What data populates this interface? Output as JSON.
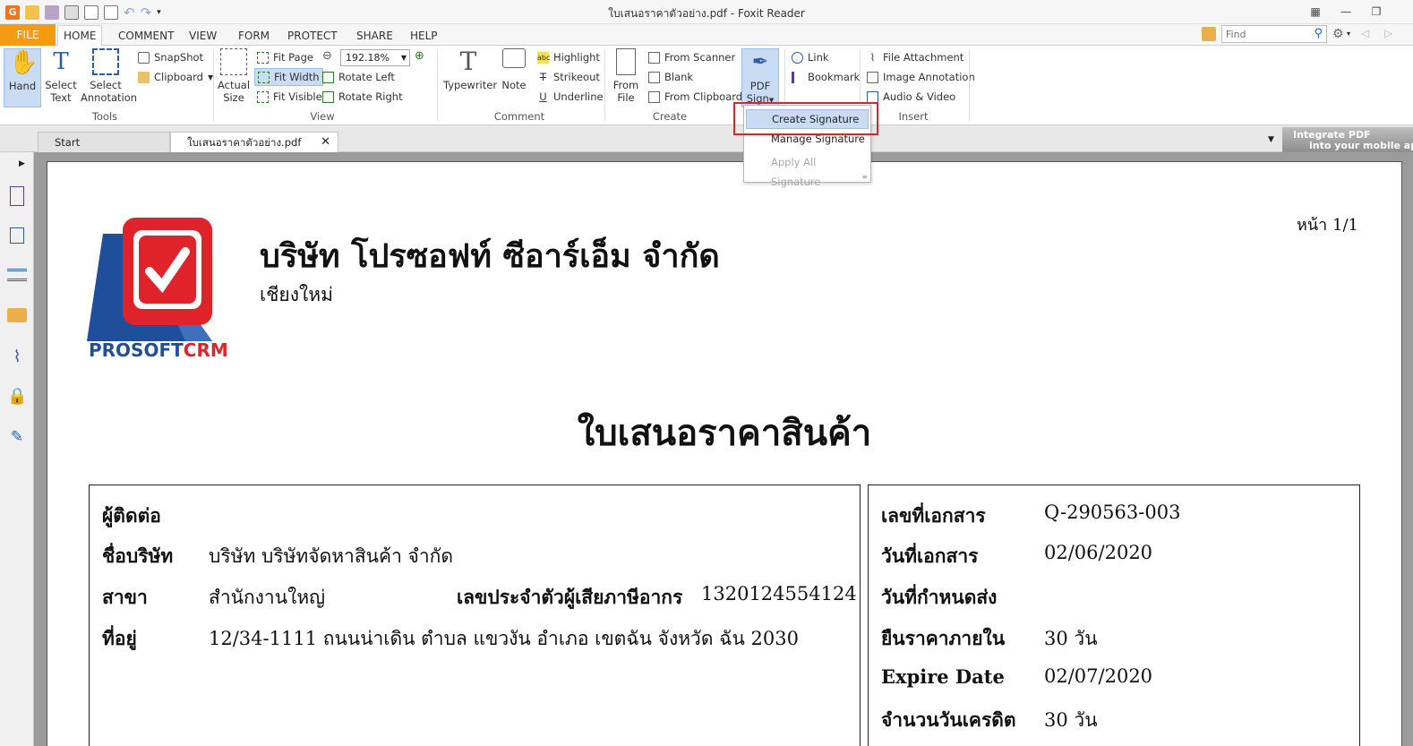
{
  "window": {
    "title": "ใบเสนอราคาตัวอย่าง.pdf - Foxit Reader"
  },
  "menu": {
    "tabs": [
      "FILE",
      "HOME",
      "COMMENT",
      "VIEW",
      "FORM",
      "PROTECT",
      "SHARE",
      "HELP"
    ],
    "find_placeholder": "Find"
  },
  "ribbon": {
    "tools": {
      "hand": "Hand",
      "select_text": [
        "Select",
        "Text"
      ],
      "select_annotation": [
        "Select",
        "Annotation"
      ],
      "snapshot": "SnapShot",
      "clipboard": "Clipboard",
      "label": "Tools"
    },
    "view": {
      "actual_size": [
        "Actual",
        "Size"
      ],
      "fit_page": "Fit Page",
      "fit_width": "Fit Width",
      "fit_visible": "Fit Visible",
      "zoom": "192.18%",
      "rotate_left": "Rotate Left",
      "rotate_right": "Rotate Right",
      "label": "View"
    },
    "comment": {
      "typewriter": "Typewriter",
      "note": "Note",
      "highlight": "Highlight",
      "strikeout": "Strikeout",
      "underline": "Underline",
      "label": "Comment"
    },
    "create": {
      "from_file": [
        "From",
        "File"
      ],
      "from_scanner": "From Scanner",
      "blank": "Blank",
      "from_clipboard": "From Clipboard",
      "label": "Create"
    },
    "pdf_sign": {
      "line1": "PDF",
      "line2": "Sign"
    },
    "links": {
      "link": "Link",
      "bookmark": "Bookmark"
    },
    "insert": {
      "file_attachment": "File Attachment",
      "image_annotation": "Image Annotation",
      "audio_video": "Audio & Video",
      "label": "Insert"
    }
  },
  "dropdown": {
    "create_signature": "Create Signature",
    "manage_signature": "Manage Signature",
    "apply_all_signature": "Apply All Signature"
  },
  "tabs": {
    "start": "Start",
    "document": "ใบเสนอราคาตัวอย่าง.pdf",
    "banner_line1": "Integrate PDF",
    "banner_line2": "into your mobile ap"
  },
  "document": {
    "logo_text_1": "PROSOFT",
    "logo_text_2": "CRM",
    "company": "บริษัท โปรซอฟท์ ซีอาร์เอ็ม จำกัด",
    "branch_city": "เชียงใหม่",
    "page_no": "หน้า 1/1",
    "title": "ใบเสนอราคาสินค้า",
    "left": {
      "contact_label": "ผู้ติดต่อ",
      "company_label": "ชื่อบริษัท",
      "company_value": "บริษัท บริษัทจัดหาสินค้า จำกัด",
      "branch_label": "สาขา",
      "branch_value": "สำนักงานใหญ่",
      "taxid_label": "เลขประจำตัวผู้เสียภาษีอากร",
      "taxid_value": "1320124554124",
      "address_label": "ที่อยู่",
      "address_value": "12/34-1111  ถนนน่าเดิน  ตำบล แขวงัน อำเภอ เขตฉัน จังหวัด ฉัน 2030"
    },
    "right": {
      "docno_label": "เลขที่เอกสาร",
      "docno_value": "Q-290563-003",
      "docdate_label": "วันที่เอกสาร",
      "docdate_value": "02/06/2020",
      "due_label": "วันที่กำหนดส่ง",
      "validity_label": "ยืนราคาภายใน",
      "validity_value": "30 วัน",
      "expire_label": "Expire Date",
      "expire_value": "02/07/2020",
      "credit_label": "จำนวนวันเครดิต",
      "credit_value": "30 วัน"
    }
  },
  "colors": {
    "file_tab": "#f39c12",
    "highlight_box": "#e0222b",
    "selected_bg": "#c9dcf3",
    "logo_red": "#e0222b",
    "logo_blue": "#1f4e9a"
  }
}
